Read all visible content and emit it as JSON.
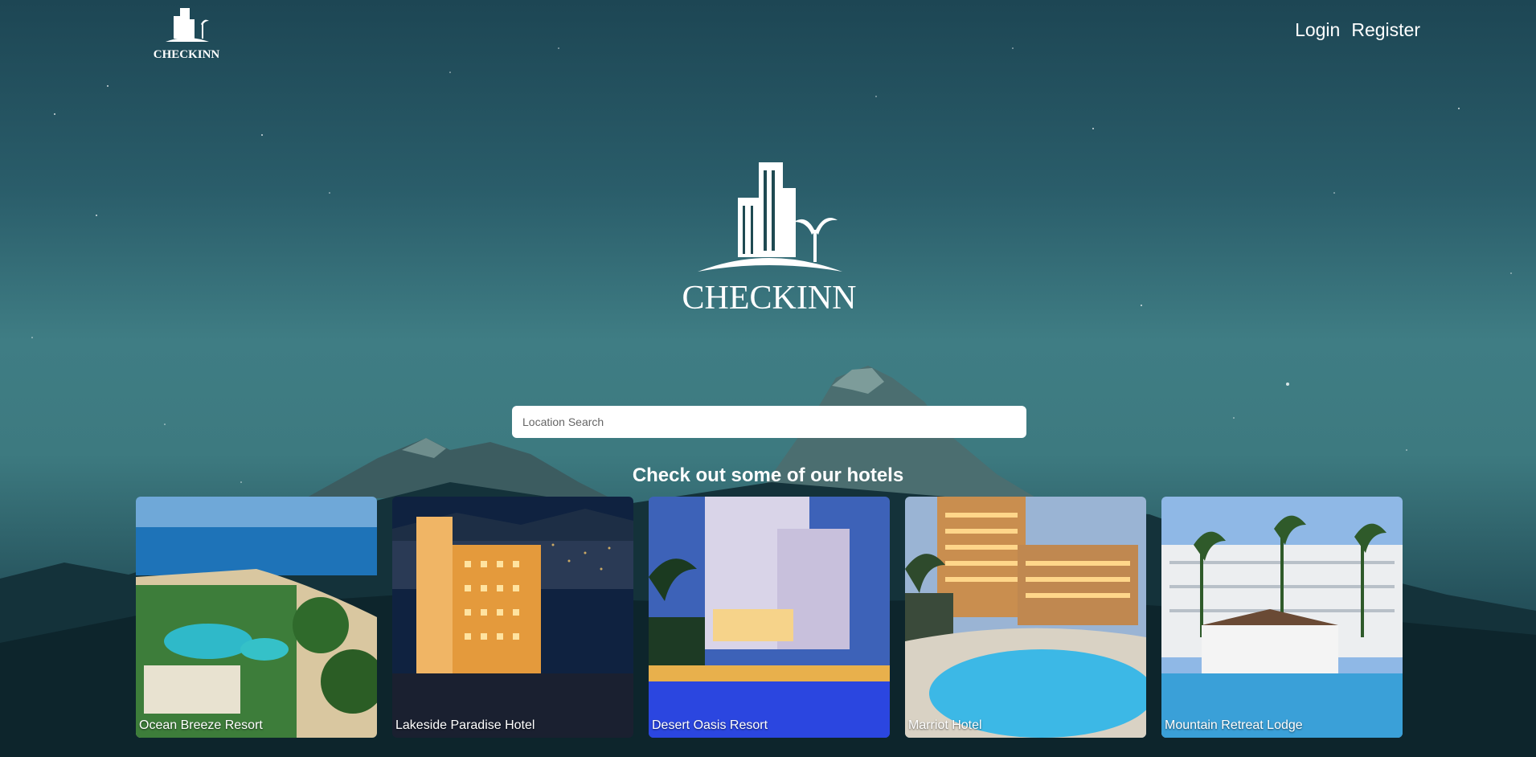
{
  "brand": {
    "name": "CHECKINN",
    "logo_icon": "checkinn-building-palm-logo"
  },
  "nav": {
    "login": "Login",
    "register": "Register"
  },
  "search": {
    "placeholder": "Location Search",
    "value": ""
  },
  "hotels_section": {
    "title": "Check out some of our hotels",
    "hotels": [
      {
        "name": "Ocean Breeze Resort"
      },
      {
        "name": "Lakeside Paradise Hotel"
      },
      {
        "name": "Desert Oasis Resort"
      },
      {
        "name": "Marriot Hotel"
      },
      {
        "name": "Mountain Retreat Lodge"
      }
    ]
  },
  "colors": {
    "sky_top": "#1d4654",
    "sky_mid": "#3f7d84",
    "mountain": "#3a5a5e",
    "search_bg": "#ffffff"
  }
}
